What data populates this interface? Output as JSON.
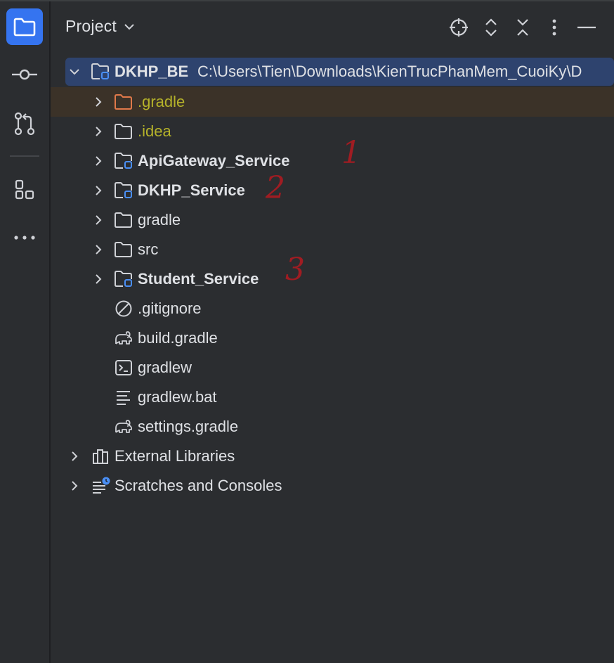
{
  "header": {
    "title": "Project"
  },
  "tree": {
    "root": {
      "label": "DKHP_BE",
      "path": "C:\\Users\\Tien\\Downloads\\KienTrucPhanMem_CuoiKy\\D"
    },
    "items": [
      {
        "label": ".gradle"
      },
      {
        "label": ".idea"
      },
      {
        "label": "ApiGateway_Service"
      },
      {
        "label": "DKHP_Service"
      },
      {
        "label": "gradle"
      },
      {
        "label": "src"
      },
      {
        "label": "Student_Service"
      },
      {
        "label": ".gitignore"
      },
      {
        "label": "build.gradle"
      },
      {
        "label": "gradlew"
      },
      {
        "label": "gradlew.bat"
      },
      {
        "label": "settings.gradle"
      }
    ],
    "external_libraries": "External Libraries",
    "scratches": "Scratches and Consoles"
  },
  "annotations": [
    "1",
    "2",
    "3"
  ],
  "colors": {
    "accent": "#3574f0",
    "selection": "#2e436e",
    "excluded_folder": "#e0794a",
    "ignored_text": "#b5b22a",
    "annotation": "#a01c22"
  }
}
